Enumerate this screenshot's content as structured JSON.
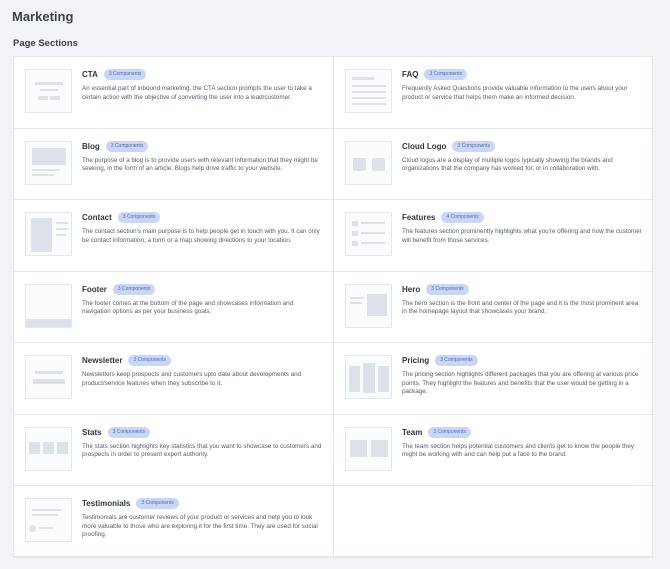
{
  "header": {
    "title": "Marketing",
    "section_title": "Page Sections"
  },
  "colors": {
    "badge_bg": "#c9d7f6",
    "badge_text": "#4f69b8",
    "thumb_shape": "#dde2ea",
    "page_bg": "#f2f4f7"
  },
  "sections": [
    {
      "name": "CTA",
      "badge": "3 Components",
      "icon": "cta-thumbnail-icon",
      "description": "An essential part of inbound marketing, the CTA section prompts the user to take a certain action with the objective of converting the user into a lead/customer."
    },
    {
      "name": "FAQ",
      "badge": "3 Components",
      "icon": "faq-thumbnail-icon",
      "description": "Frequently Asked Questions provide valuable information to the users about your product or service that helps them make an informed decision."
    },
    {
      "name": "Blog",
      "badge": "3 Components",
      "icon": "blog-thumbnail-icon",
      "description": "The purpose of a blog is to provide users with relevant information that they might be seeking, in the form of an article. Blogs help drive traffic to your website."
    },
    {
      "name": "Cloud Logo",
      "badge": "3 Components",
      "icon": "cloud-logo-thumbnail-icon",
      "description": "Cloud logos are a display of multiple logos typically showing the brands and organizations that the company has worked for, or in collaboration with."
    },
    {
      "name": "Contact",
      "badge": "3 Components",
      "icon": "contact-thumbnail-icon",
      "description": "The contact section's main purpose is to help people get in touch with you. It can only be contact information, a form or a map showing directions to your location."
    },
    {
      "name": "Features",
      "badge": "4 Components",
      "icon": "features-thumbnail-icon",
      "description": "The features section prominently highlights what you're offering and how the customer will benefit from those services."
    },
    {
      "name": "Footer",
      "badge": "3 Components",
      "icon": "footer-thumbnail-icon",
      "description": "The footer comes at the bottom of the page and showcases information and navigation options as per your business goals."
    },
    {
      "name": "Hero",
      "badge": "3 Components",
      "icon": "hero-thumbnail-icon",
      "description": "The hero section is the front and center of the page and it is the most prominent area in the homepage layout that showcases your brand."
    },
    {
      "name": "Newsletter",
      "badge": "3 Components",
      "icon": "newsletter-thumbnail-icon",
      "description": "Newsletters keep prospects and customers upto date about developments and product/service features when they subscribe to it."
    },
    {
      "name": "Pricing",
      "badge": "3 Components",
      "icon": "pricing-thumbnail-icon",
      "description": "The pricing section highlights different packages that you are offering at various price points. They highlight the features and benefits that the user would be getting in a package."
    },
    {
      "name": "Stats",
      "badge": "3 Components",
      "icon": "stats-thumbnail-icon",
      "description": "The stats section highlights key statistics that you want to showcase to customers and prospects in order to present expert authority."
    },
    {
      "name": "Team",
      "badge": "3 Components",
      "icon": "team-thumbnail-icon",
      "description": "The team section helps potential customers and clients get to know the people they might be working with and can help put a face to the brand."
    },
    {
      "name": "Testimonials",
      "badge": "3 Components",
      "icon": "testimonials-thumbnail-icon",
      "description": "Testimonials are customer reviews of your product or services and help you to look more valuable to those who are exploring it for the first time. They are used for social proofing."
    }
  ]
}
